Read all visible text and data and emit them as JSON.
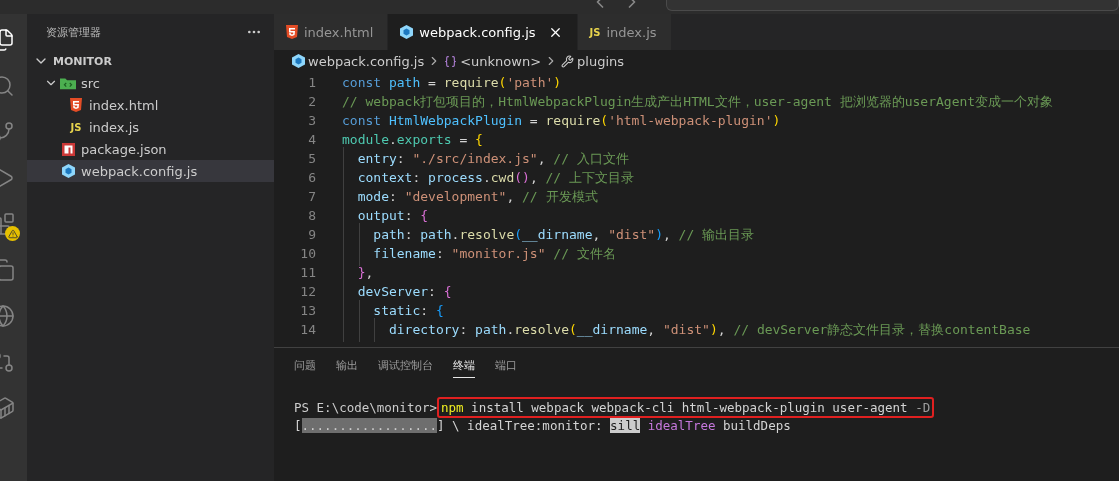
{
  "activity_bar": {
    "items": [
      {
        "kind": "files",
        "selected": true
      },
      {
        "kind": "search",
        "selected": false
      },
      {
        "kind": "git",
        "selected": false
      },
      {
        "kind": "run",
        "selected": false
      },
      {
        "kind": "extensions",
        "selected": false,
        "warning": true
      },
      {
        "kind": "remote",
        "selected": false
      },
      {
        "kind": "wasm",
        "selected": false
      },
      {
        "kind": "compare",
        "selected": false
      },
      {
        "kind": "docker",
        "selected": false
      }
    ]
  },
  "sidebar": {
    "title": "资源管理器",
    "section": "MONITOR",
    "items": [
      {
        "name": "src",
        "kind": "folder",
        "expanded": true,
        "selected": false,
        "children": [
          {
            "name": "index.html",
            "kind": "html",
            "selected": false
          },
          {
            "name": "index.js",
            "kind": "js",
            "icon_label": "JS",
            "selected": false
          }
        ]
      },
      {
        "name": "package.json",
        "kind": "npm",
        "selected": false
      },
      {
        "name": "webpack.config.js",
        "kind": "webpack",
        "selected": true
      }
    ]
  },
  "tabs": [
    {
      "label": "index.html",
      "kind": "html",
      "selected": false
    },
    {
      "label": "webpack.config.js",
      "kind": "webpack",
      "selected": true
    },
    {
      "label": "index.js",
      "kind": "js",
      "icon_label": "JS",
      "selected": false
    }
  ],
  "breadcrumb": [
    {
      "label": "webpack.config.js",
      "kind": "webpack"
    },
    {
      "label": "<unknown>",
      "kind": "variable"
    },
    {
      "label": "plugins",
      "kind": "wrench"
    }
  ],
  "code_lines": [
    {
      "number": "1",
      "kind": "flat",
      "tokens": [
        {
          "kind": "keyword",
          "text": "const "
        },
        {
          "kind": "constant",
          "text": "path"
        },
        {
          "kind": "plain",
          "text": " = "
        },
        {
          "kind": "function",
          "text": "require"
        },
        {
          "kind": "bracket1",
          "text": "("
        },
        {
          "kind": "string",
          "text": "'path'"
        },
        {
          "kind": "bracket1",
          "text": ")"
        }
      ]
    },
    {
      "number": "2",
      "kind": "flat",
      "tokens": [
        {
          "kind": "comment",
          "text": "// webpack打包项目的，HtmlWebpackPlugin生成产出HTML文件，user-agent 把浏览器的userAgent变成一个对象"
        }
      ]
    },
    {
      "number": "3",
      "kind": "flat",
      "tokens": [
        {
          "kind": "keyword",
          "text": "const "
        },
        {
          "kind": "constant",
          "text": "HtmlWebpackPlugin"
        },
        {
          "kind": "plain",
          "text": " = "
        },
        {
          "kind": "function",
          "text": "require"
        },
        {
          "kind": "bracket1",
          "text": "("
        },
        {
          "kind": "string",
          "text": "'html-webpack-plugin'"
        },
        {
          "kind": "bracket1",
          "text": ")"
        }
      ]
    },
    {
      "number": "4",
      "kind": "flat",
      "tokens": [
        {
          "kind": "module",
          "text": "module"
        },
        {
          "kind": "plain",
          "text": "."
        },
        {
          "kind": "module",
          "text": "exports"
        },
        {
          "kind": "plain",
          "text": " = "
        },
        {
          "kind": "bracket1",
          "text": "{"
        }
      ]
    },
    {
      "number": "5",
      "kind": "single",
      "tokens": [
        {
          "kind": "variable",
          "text": "entry"
        },
        {
          "kind": "plain",
          "text": ": "
        },
        {
          "kind": "string",
          "text": "\"./src/index.js\""
        },
        {
          "kind": "plain",
          "text": ", "
        },
        {
          "kind": "comment",
          "text": "// 入口文件"
        }
      ]
    },
    {
      "number": "6",
      "kind": "single",
      "tokens": [
        {
          "kind": "variable",
          "text": "context"
        },
        {
          "kind": "plain",
          "text": ": "
        },
        {
          "kind": "variable",
          "text": "process"
        },
        {
          "kind": "plain",
          "text": "."
        },
        {
          "kind": "function",
          "text": "cwd"
        },
        {
          "kind": "bracket2",
          "text": "()"
        },
        {
          "kind": "plain",
          "text": ", "
        },
        {
          "kind": "comment",
          "text": "// 上下文目录"
        }
      ]
    },
    {
      "number": "7",
      "kind": "single",
      "tokens": [
        {
          "kind": "variable",
          "text": "mode"
        },
        {
          "kind": "plain",
          "text": ": "
        },
        {
          "kind": "string",
          "text": "\"development\""
        },
        {
          "kind": "plain",
          "text": ", "
        },
        {
          "kind": "comment",
          "text": "// 开发模式"
        }
      ]
    },
    {
      "number": "8",
      "kind": "single",
      "tokens": [
        {
          "kind": "variable",
          "text": "output"
        },
        {
          "kind": "plain",
          "text": ": "
        },
        {
          "kind": "bracket2",
          "text": "{"
        }
      ]
    },
    {
      "number": "9",
      "kind": "double",
      "tokens": [
        {
          "kind": "variable",
          "text": "path"
        },
        {
          "kind": "plain",
          "text": ": "
        },
        {
          "kind": "variable",
          "text": "path"
        },
        {
          "kind": "plain",
          "text": "."
        },
        {
          "kind": "function",
          "text": "resolve"
        },
        {
          "kind": "bracket3",
          "text": "("
        },
        {
          "kind": "variable",
          "text": "__dirname"
        },
        {
          "kind": "plain",
          "text": ", "
        },
        {
          "kind": "string",
          "text": "\"dist\""
        },
        {
          "kind": "bracket3",
          "text": ")"
        },
        {
          "kind": "plain",
          "text": ", "
        },
        {
          "kind": "comment",
          "text": "// 输出目录"
        }
      ]
    },
    {
      "number": "10",
      "kind": "double",
      "tokens": [
        {
          "kind": "variable",
          "text": "filename"
        },
        {
          "kind": "plain",
          "text": ": "
        },
        {
          "kind": "string",
          "text": "\"monitor.js\" "
        },
        {
          "kind": "comment",
          "text": "// 文件名"
        }
      ]
    },
    {
      "number": "11",
      "kind": "single",
      "tokens": [
        {
          "kind": "bracket2",
          "text": "}"
        },
        {
          "kind": "plain",
          "text": ","
        }
      ]
    },
    {
      "number": "12",
      "kind": "single",
      "tokens": [
        {
          "kind": "variable",
          "text": "devServer"
        },
        {
          "kind": "plain",
          "text": ": "
        },
        {
          "kind": "bracket2",
          "text": "{"
        }
      ]
    },
    {
      "number": "13",
      "kind": "double",
      "tokens": [
        {
          "kind": "variable",
          "text": "static"
        },
        {
          "kind": "plain",
          "text": ": "
        },
        {
          "kind": "bracket3",
          "text": "{"
        }
      ]
    },
    {
      "number": "14",
      "kind": "triple",
      "tokens": [
        {
          "kind": "variable",
          "text": "directory"
        },
        {
          "kind": "plain",
          "text": ": "
        },
        {
          "kind": "variable",
          "text": "path"
        },
        {
          "kind": "plain",
          "text": "."
        },
        {
          "kind": "function",
          "text": "resolve"
        },
        {
          "kind": "bracket1",
          "text": "("
        },
        {
          "kind": "variable",
          "text": "__dirname"
        },
        {
          "kind": "plain",
          "text": ", "
        },
        {
          "kind": "string",
          "text": "\"dist\""
        },
        {
          "kind": "bracket1",
          "text": ")"
        },
        {
          "kind": "plain",
          "text": ", "
        },
        {
          "kind": "comment",
          "text": "// devServer静态文件目录，替换contentBase"
        }
      ]
    }
  ],
  "panel_tabs": [
    {
      "label": "问题",
      "selected": false
    },
    {
      "label": "输出",
      "selected": false
    },
    {
      "label": "调试控制台",
      "selected": false
    },
    {
      "label": "终端",
      "selected": true
    },
    {
      "label": "端口",
      "selected": false
    }
  ],
  "terminal": {
    "prompt": "PS E:\\code\\monitor>",
    "command": [
      {
        "kind": "command",
        "text": "npm"
      },
      {
        "kind": "plain",
        "text": " install webpack webpack-cli html-webpack-plugin user-agent "
      },
      {
        "kind": "flag",
        "text": "-D"
      }
    ],
    "command_boxed": true,
    "progress_line": [
      {
        "kind": "plain",
        "text": "["
      },
      {
        "kind": "bar",
        "text": ".................."
      },
      {
        "kind": "plain",
        "text": "] \\ idealTree:monitor: "
      },
      {
        "kind": "inverse",
        "text": "sill"
      },
      {
        "kind": "magenta",
        "text": " idealTree"
      },
      {
        "kind": "plain",
        "text": " buildDeps"
      }
    ]
  }
}
